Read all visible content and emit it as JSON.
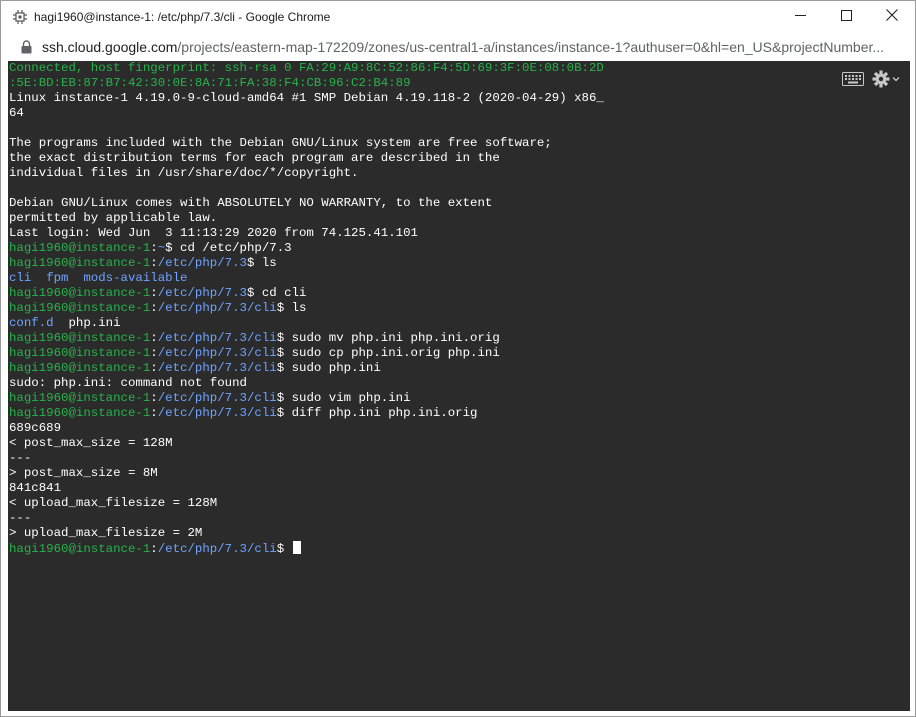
{
  "window": {
    "title": "hagi1960@instance-1: /etc/php/7.3/cli - Google Chrome"
  },
  "address": {
    "host": "ssh.cloud.google.com",
    "path": "/projects/eastern-map-172209/zones/us-central1-a/instances/instance-1?authuser=0&hl=en_US&projectNumber..."
  },
  "colors": {
    "terminal_bg": "#2b2b2b",
    "prompt_green": "#26b34a",
    "path_blue": "#6fa3ff",
    "text": "#ffffff"
  },
  "icons": {
    "app": "chip-icon",
    "lock": "lock-icon",
    "minimize": "minimize-icon",
    "maximize": "maximize-icon",
    "close": "close-icon",
    "keyboard": "keyboard-icon",
    "settings": "gear-icon"
  },
  "terminal": {
    "connected_1": "Connected, host fingerprint: ssh-rsa 0 FA:29:A9:8C:52:86:F4:5D:69:3F:0E:08:0B:2D",
    "connected_2": ":5E:BD:EB:87:B7:42:30:0E:8A:71:FA:38:F4:CB:96:C2:B4:89",
    "uname_1": "Linux instance-1 4.19.0-9-cloud-amd64 #1 SMP Debian 4.19.118-2 (2020-04-29) x86_",
    "uname_2": "64",
    "motd_1": "The programs included with the Debian GNU/Linux system are free software;",
    "motd_2": "the exact distribution terms for each program are described in the",
    "motd_3": "individual files in /usr/share/doc/*/copyright.",
    "motd_4": "Debian GNU/Linux comes with ABSOLUTELY NO WARRANTY, to the extent",
    "motd_5": "permitted by applicable law.",
    "last_login": "Last login: Wed Jun  3 11:13:29 2020 from 74.125.41.101",
    "user": "hagi1960@instance-1",
    "colon": ":",
    "path_home": "~",
    "path_php": "/etc/php/7.3",
    "path_cli": "/etc/php/7.3/cli",
    "dollar": "$ ",
    "cmd_1": "cd /etc/php/7.3",
    "cmd_2": "ls",
    "ls_1": [
      "cli",
      "fpm",
      "mods-available"
    ],
    "cmd_3": "cd cli",
    "cmd_4": "ls",
    "ls_2_dir": "conf.d",
    "ls_2_file": "php.ini",
    "cmd_5": "sudo mv php.ini php.ini.orig",
    "cmd_6": "sudo cp php.ini.orig php.ini",
    "cmd_7": "sudo php.ini",
    "err_1": "sudo: php.ini: command not found",
    "cmd_8": "sudo vim php.ini",
    "cmd_9": "diff php.ini php.ini.orig",
    "diff_1": "689c689",
    "diff_2": "< post_max_size = 128M",
    "diff_3": "---",
    "diff_4": "> post_max_size = 8M",
    "diff_5": "841c841",
    "diff_6": "< upload_max_filesize = 128M",
    "diff_7": "---",
    "diff_8": "> upload_max_filesize = 2M"
  }
}
